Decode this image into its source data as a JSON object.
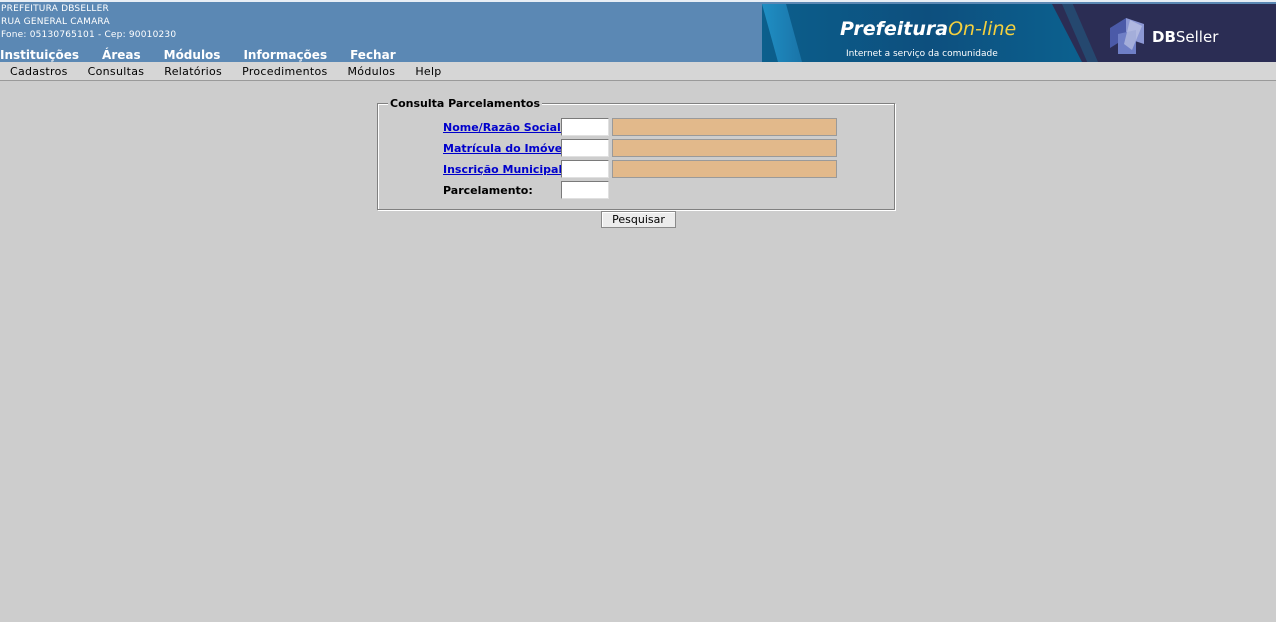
{
  "header": {
    "org_lines": [
      "PREFEITURA DBSELLER",
      "RUA GENERAL CAMARA",
      "Fone: 05130765101  - Cep: 90010230"
    ],
    "main_menu": [
      "Instituições",
      "Áreas",
      "Módulos",
      "Informações",
      "Fechar"
    ],
    "banner": {
      "brand_part1": "Prefeitura",
      "brand_part2": "On-line",
      "tagline": "Internet a serviço da comunidade",
      "vendor_bold": "DB",
      "vendor_rest": "Seller",
      "colors": {
        "accent_yellow": "#f4d03f",
        "banner_blue": "#0c5f8c",
        "vendor_bg": "#2b2d54"
      }
    }
  },
  "submenu": [
    "Cadastros",
    "Consultas",
    "Relatórios",
    "Procedimentos",
    "Módulos",
    "Help"
  ],
  "form": {
    "legend": "Consulta Parcelamentos",
    "fields": [
      {
        "label": "Nome/Razão Social:",
        "value": "",
        "description": ""
      },
      {
        "label": "Matrícula do Imóvel:",
        "value": "",
        "description": ""
      },
      {
        "label": "Inscrição Municipal:",
        "value": "",
        "description": ""
      },
      {
        "label": "Parcelamento:",
        "value": ""
      }
    ],
    "search_button": "Pesquisar"
  }
}
